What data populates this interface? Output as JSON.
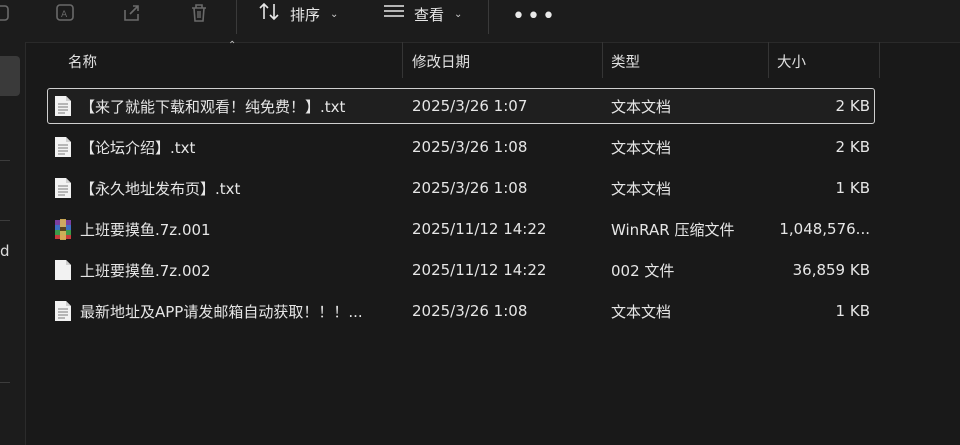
{
  "toolbar": {
    "sort_label": "排序",
    "view_label": "查看",
    "more_label": "•••",
    "icons": [
      "cut-icon",
      "ai-icon",
      "share-icon",
      "delete-icon",
      "sort-icon",
      "view-icon"
    ]
  },
  "sidebar": {
    "visible_letter": "d"
  },
  "columns": {
    "name": "名称",
    "date": "修改日期",
    "type": "类型",
    "size": "大小"
  },
  "files": [
    {
      "name": "【来了就能下载和观看！纯免费！】.txt",
      "date": "2025/3/26 1:07",
      "type": "文本文档",
      "size": "2 KB",
      "icon": "text-file-icon"
    },
    {
      "name": "【论坛介绍】.txt",
      "date": "2025/3/26 1:08",
      "type": "文本文档",
      "size": "2 KB",
      "icon": "text-file-icon"
    },
    {
      "name": "【永久地址发布页】.txt",
      "date": "2025/3/26 1:08",
      "type": "文本文档",
      "size": "1 KB",
      "icon": "text-file-icon"
    },
    {
      "name": "上班要摸鱼.7z.001",
      "date": "2025/11/12 14:22",
      "type": "WinRAR 压缩文件",
      "size": "1,048,576...",
      "icon": "winrar-archive-icon"
    },
    {
      "name": "上班要摸鱼.7z.002",
      "date": "2025/11/12 14:22",
      "type": "002 文件",
      "size": "36,859 KB",
      "icon": "blank-file-icon"
    },
    {
      "name": "最新地址及APP请发邮箱自动获取！！！...",
      "date": "2025/3/26 1:08",
      "type": "文本文档",
      "size": "1 KB",
      "icon": "text-file-icon"
    }
  ],
  "colors": {
    "background": "#191919",
    "text": "#e6e6e6",
    "selection_border": "#cfcfcf"
  }
}
